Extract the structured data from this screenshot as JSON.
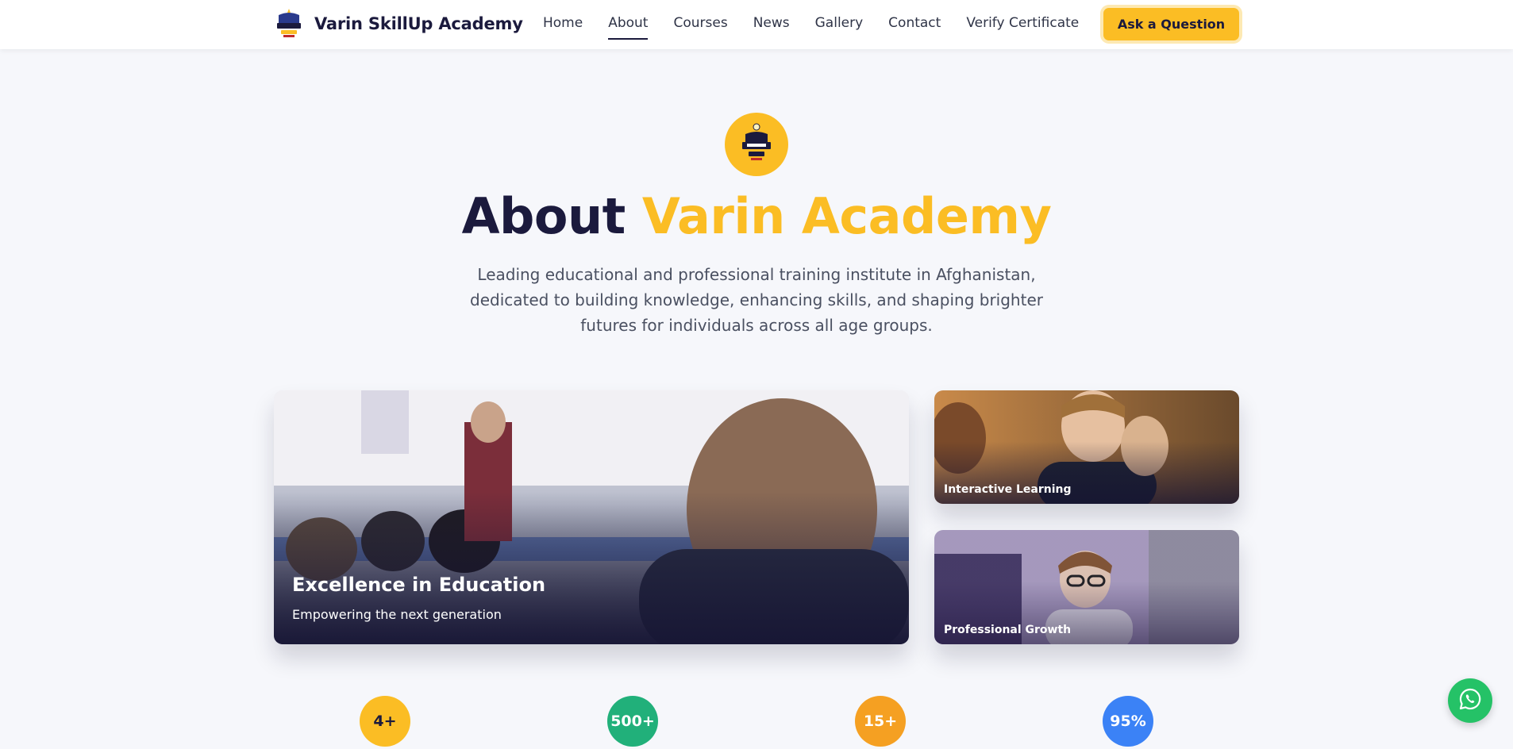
{
  "navbar": {
    "brand_name": "Varin SkillUp Academy",
    "links": [
      {
        "label": "Home",
        "active": false
      },
      {
        "label": "About",
        "active": true
      },
      {
        "label": "Courses",
        "active": false
      },
      {
        "label": "News",
        "active": false
      },
      {
        "label": "Gallery",
        "active": false
      },
      {
        "label": "Contact",
        "active": false
      },
      {
        "label": "Verify Certificate",
        "active": false
      }
    ],
    "cta_label": "Ask a Question"
  },
  "hero": {
    "badge_icon": "academy-logo-icon",
    "title_part1": "About",
    "title_part2": "Varin Academy",
    "description": "Leading educational and professional training institute in Afghanistan, dedicated to building knowledge, enhancing skills, and shaping brighter futures for individuals across all age groups."
  },
  "gallery": {
    "main": {
      "title": "Excellence in Education",
      "subtitle": "Empowering the next generation"
    },
    "side1": {
      "label": "Interactive Learning"
    },
    "side2": {
      "label": "Professional Growth"
    }
  },
  "stats": [
    {
      "value": "4+",
      "color": "#fbbd24"
    },
    {
      "value": "500+",
      "color": "#21b07a"
    },
    {
      "value": "15+",
      "color": "#f5a022"
    },
    {
      "value": "95%",
      "color": "#3b82f6"
    }
  ],
  "colors": {
    "primary": "#1b1a3d",
    "accent": "#fbbd24",
    "background": "#f6f7fb",
    "whatsapp": "#25c267"
  },
  "floating": {
    "icon": "whatsapp-icon"
  }
}
